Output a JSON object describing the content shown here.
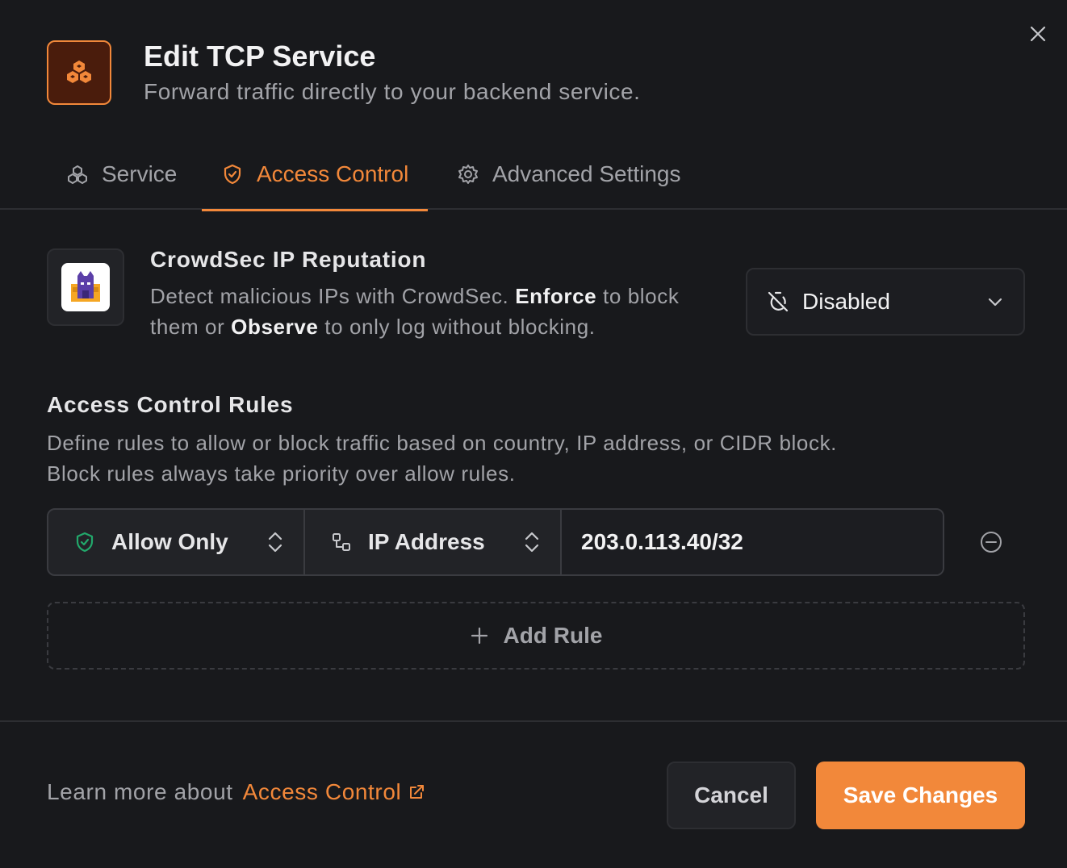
{
  "dialog": {
    "title": "Edit TCP Service",
    "subtitle": "Forward traffic directly to your backend service.",
    "close_icon": "close-icon",
    "header_icon": "boxes-icon"
  },
  "tabs": [
    {
      "label": "Service",
      "icon": "boxes-icon",
      "active": false
    },
    {
      "label": "Access Control",
      "icon": "shield-check-icon",
      "active": true
    },
    {
      "label": "Advanced Settings",
      "icon": "gear-icon",
      "active": false
    }
  ],
  "crowdsec": {
    "title": "CrowdSec IP Reputation",
    "desc_part1": "Detect malicious IPs with CrowdSec. ",
    "desc_enforce": "Enforce",
    "desc_part2": " to block them or ",
    "desc_observe": "Observe",
    "desc_part3": " to only log without blocking.",
    "mode_value": "Disabled",
    "mode_icon": "timer-off-icon"
  },
  "rules": {
    "title": "Access Control Rules",
    "desc_line1": "Define rules to allow or block traffic based on country, IP address, or CIDR block.",
    "desc_line2": "Block rules always take priority over allow rules.",
    "items": [
      {
        "action": "Allow Only",
        "type": "IP Address",
        "value": "203.0.113.40/32"
      }
    ],
    "add_label": "Add Rule"
  },
  "footer": {
    "learn_prefix": "Learn more about",
    "learn_link": "Access Control",
    "cancel_label": "Cancel",
    "save_label": "Save Changes"
  },
  "colors": {
    "accent": "#f2883a",
    "background": "#18191c",
    "allow_green": "#22a86b"
  }
}
